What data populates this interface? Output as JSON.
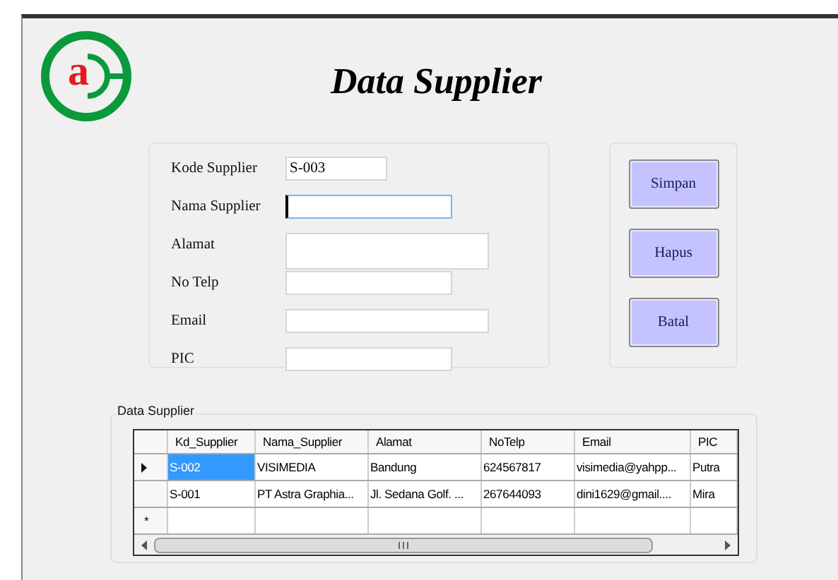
{
  "logo": {
    "letter": "a"
  },
  "title": "Data Supplier",
  "form": {
    "fields": [
      {
        "label": "Kode Supplier",
        "value": "S-003",
        "focused": false,
        "kind": "short"
      },
      {
        "label": "Nama Supplier",
        "focused": true,
        "kind": "medium"
      },
      {
        "label": "Alamat",
        "focused": false,
        "kind": "tall"
      },
      {
        "label": "No Telp",
        "focused": false,
        "kind": "medium"
      },
      {
        "label": "Email",
        "focused": false,
        "kind": "long"
      },
      {
        "label": "PIC",
        "focused": false,
        "kind": "medium"
      }
    ]
  },
  "buttons": [
    {
      "label": "Simpan"
    },
    {
      "label": "Hapus"
    },
    {
      "label": "Batal"
    }
  ],
  "grid": {
    "group_title": "Data Supplier",
    "columns": [
      "Kd_Supplier",
      "Nama_Supplier",
      "Alamat",
      "NoTelp",
      "Email",
      "PIC"
    ],
    "rows": [
      {
        "selected": true,
        "cells": [
          "S-002",
          "VISIMEDIA",
          "Bandung",
          "624567817",
          "visimedia@yahpp...",
          "Putra"
        ]
      },
      {
        "selected": false,
        "cells": [
          "S-001",
          "PT Astra Graphia...",
          "Jl. Sedana Golf. ...",
          "267644093",
          "dini1629@gmail....",
          "Mira"
        ]
      }
    ],
    "new_row_marker": "*"
  }
}
